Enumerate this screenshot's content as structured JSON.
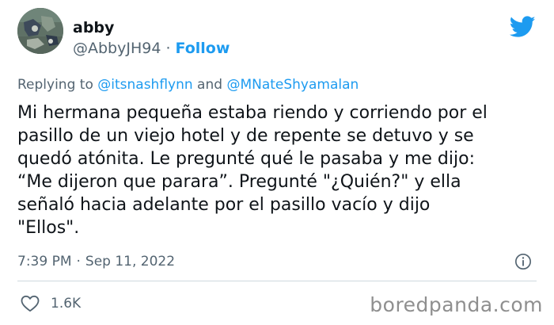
{
  "author": {
    "display_name": "abby",
    "handle": "@AbbyJH94",
    "separator": "·",
    "follow_label": "Follow"
  },
  "reply": {
    "prefix": "Replying to",
    "mention_1": "@itsnashflynn",
    "conjunction": "and",
    "mention_2": "@MNateShyamalan"
  },
  "tweet": {
    "lines": [
      "Mi hermana pequeña estaba riendo y corriendo por el",
      "pasillo de un viejo hotel y de repente se detuvo y se",
      "quedó atónita. Le pregunté qué le pasaba y me dijo:",
      "“Me dijeron que parara”. Pregunté \"¿Quién?\" y ella",
      "señaló hacia adelante por el pasillo vacío y dijo",
      "\"Ellos\"."
    ],
    "time": "7:39 PM",
    "separator": "·",
    "date": "Sep 11, 2022"
  },
  "engagement": {
    "likes": "1.6K"
  },
  "watermark": "boredpanda.com",
  "icons": {
    "platform": "twitter-bird-icon",
    "info": "info-icon",
    "like": "heart-icon"
  },
  "colors": {
    "accent": "#1d9bf0",
    "text": "#0f1419",
    "secondary": "#536471",
    "divider": "#cfd9de",
    "watermark": "#8f8f8f"
  }
}
